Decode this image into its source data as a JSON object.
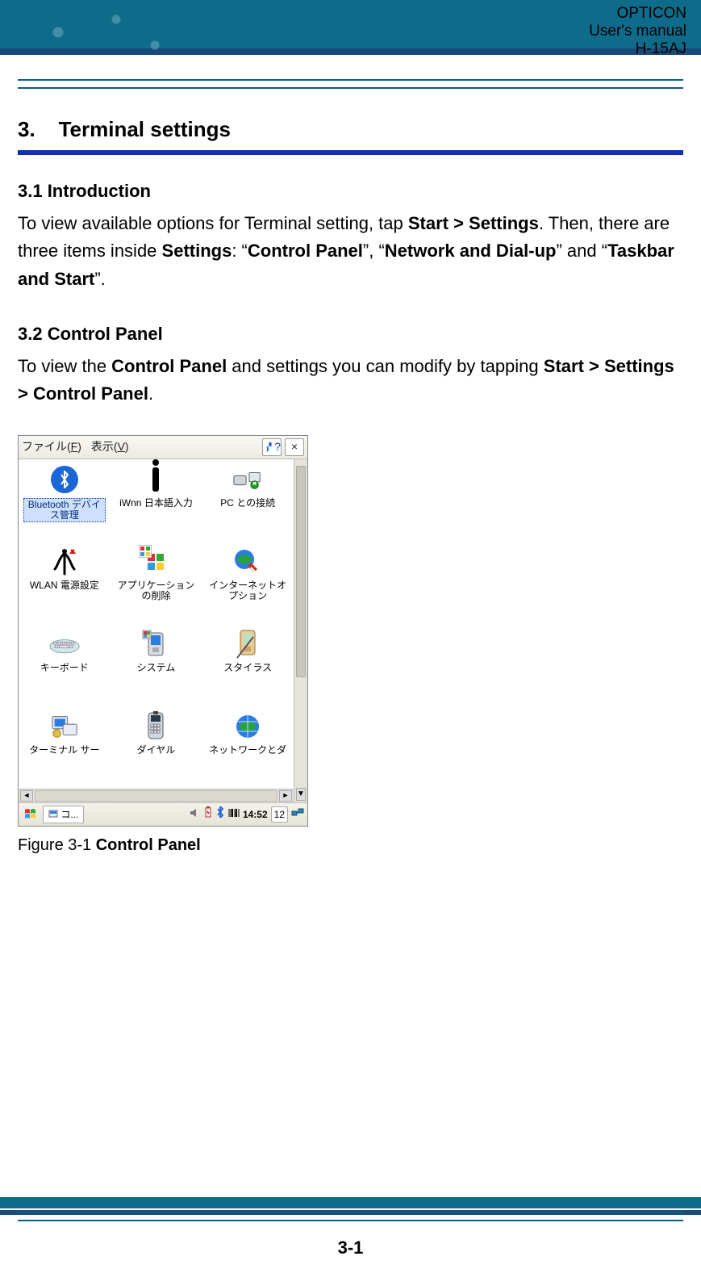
{
  "header": {
    "line1": "OPTICON",
    "line2": "User's manual",
    "line3": "H-15AJ"
  },
  "section_number": "3.",
  "section_title": "Terminal settings",
  "s31_title": "3.1 Introduction",
  "s31_t1": "To view available options for Terminal setting, tap ",
  "s31_b1": "Start > Settings",
  "s31_t2": ". Then, there are three items inside ",
  "s31_b2": "Settings",
  "s31_t3": ": “",
  "s31_b3": "Control Panel",
  "s31_t4": "”, “",
  "s31_b4": "Network and Dial-up",
  "s31_t5": "” and “",
  "s31_b5": "Taskbar and Start",
  "s31_t6": "”.",
  "s32_title": "3.2 Control Panel",
  "s32_t1": "To view the ",
  "s32_b1": "Control Panel",
  "s32_t2": " and settings you can modify by tapping ",
  "s32_b2": "Start > Settings > Control Panel",
  "s32_t3": ".",
  "fig_label": "Figure 3-1 ",
  "fig_bold": "Control Panel",
  "page_number": "3-1",
  "screenshot": {
    "menu": {
      "file": "ファイル(",
      "file_u": "F",
      "file_tail": ")",
      "view": "表示(",
      "view_u": "V",
      "view_tail": ")",
      "help": "?",
      "close": "×"
    },
    "icons": [
      {
        "key": "bluetooth",
        "label": "Bluetooth デバイス管理"
      },
      {
        "key": "iwnn",
        "label": "iWnn 日本語入力"
      },
      {
        "key": "pcconn",
        "label": "PC との接続"
      },
      {
        "key": "wlan",
        "label": "WLAN 電源設定"
      },
      {
        "key": "appdel",
        "label": "アプリケーションの削除"
      },
      {
        "key": "inet",
        "label": "インターネットオプション"
      },
      {
        "key": "keyboard",
        "label": "キーボード"
      },
      {
        "key": "system",
        "label": "システム"
      },
      {
        "key": "stylus",
        "label": "スタイラス"
      },
      {
        "key": "tserv",
        "label": "ターミナル サー"
      },
      {
        "key": "dial",
        "label": "ダイヤル"
      },
      {
        "key": "netd",
        "label": "ネットワークとダ"
      }
    ],
    "taskbar": {
      "app": "コ...",
      "time": "14:52",
      "card": "12"
    }
  }
}
